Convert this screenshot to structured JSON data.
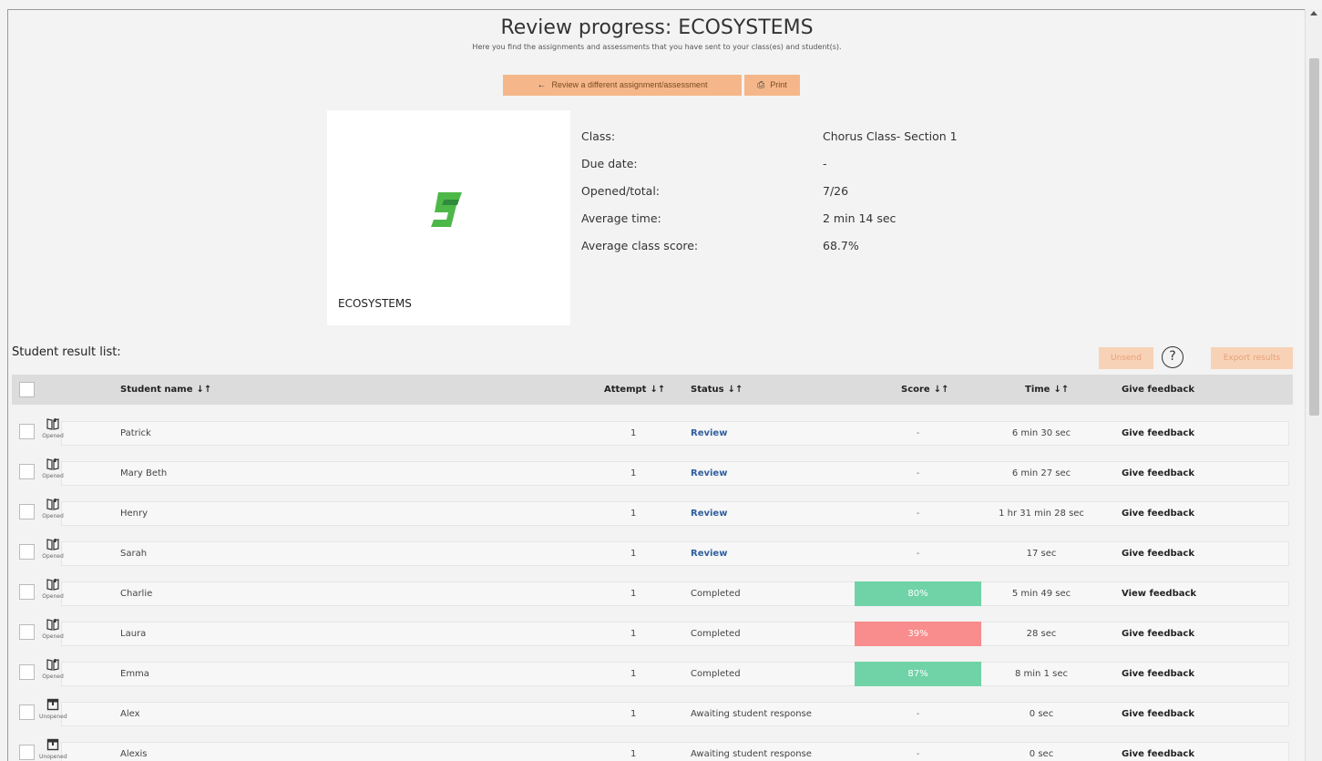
{
  "header": {
    "title": "Review progress: ECOSYSTEMS",
    "subtitle": "Here you find the assignments and assessments that you have sent to your class(es) and student(s).",
    "review_button": "Review a different assignment/assessment",
    "print_button": "Print"
  },
  "card": {
    "title": "ECOSYSTEMS",
    "logo_icon": "green-s-logo"
  },
  "details": [
    {
      "label": "Class:",
      "value": "Chorus Class- Section 1"
    },
    {
      "label": "Due date:",
      "value": "-"
    },
    {
      "label": "Opened/total:",
      "value": "7/26"
    },
    {
      "label": "Average time:",
      "value": "2 min 14 sec"
    },
    {
      "label": "Average class score:",
      "value": "68.7%"
    }
  ],
  "list": {
    "label": "Student result list:",
    "unsend_button": "Unsend",
    "help_icon": "?",
    "export_button": "Export results",
    "columns": {
      "name": "Student name",
      "attempt": "Attempt",
      "status": "Status",
      "score": "Score",
      "time": "Time",
      "feedback": "Give feedback",
      "sort_icon": "↓↑"
    },
    "rows": [
      {
        "icon_label": "Opened",
        "name": "Patrick",
        "attempt": "1",
        "status": "Review",
        "score": "-",
        "time": "6 min 30 sec",
        "feedback": "Give feedback"
      },
      {
        "icon_label": "Opened",
        "name": "Mary Beth",
        "attempt": "1",
        "status": "Review",
        "score": "-",
        "time": "6 min 27 sec",
        "feedback": "Give feedback"
      },
      {
        "icon_label": "Opened",
        "name": "Henry",
        "attempt": "1",
        "status": "Review",
        "score": "-",
        "time": "1 hr 31 min 28 sec",
        "feedback": "Give feedback"
      },
      {
        "icon_label": "Opened",
        "name": "Sarah",
        "attempt": "1",
        "status": "Review",
        "score": "-",
        "time": "17 sec",
        "feedback": "Give feedback"
      },
      {
        "icon_label": "Opened",
        "name": "Charlie",
        "attempt": "1",
        "status": "Completed",
        "score": "80%",
        "time": "5 min 49 sec",
        "feedback": "View feedback"
      },
      {
        "icon_label": "Opened",
        "name": "Laura",
        "attempt": "1",
        "status": "Completed",
        "score": "39%",
        "time": "28 sec",
        "feedback": "Give feedback"
      },
      {
        "icon_label": "Opened",
        "name": "Emma",
        "attempt": "1",
        "status": "Completed",
        "score": "87%",
        "time": "8 min 1 sec",
        "feedback": "Give feedback"
      },
      {
        "icon_label": "Unopened",
        "name": "Alex",
        "attempt": "1",
        "status": "Awaiting student response",
        "score": "-",
        "time": "0 sec",
        "feedback": "Give feedback"
      },
      {
        "icon_label": "Unopened",
        "name": "Alexis",
        "attempt": "1",
        "status": "Awaiting student response",
        "score": "-",
        "time": "0 sec",
        "feedback": "Give feedback"
      }
    ]
  },
  "colors": {
    "accent": "#f5b78a",
    "score_pass": "#6fd3a7",
    "score_fail": "#f98c8c",
    "link": "#2f5f9e"
  }
}
